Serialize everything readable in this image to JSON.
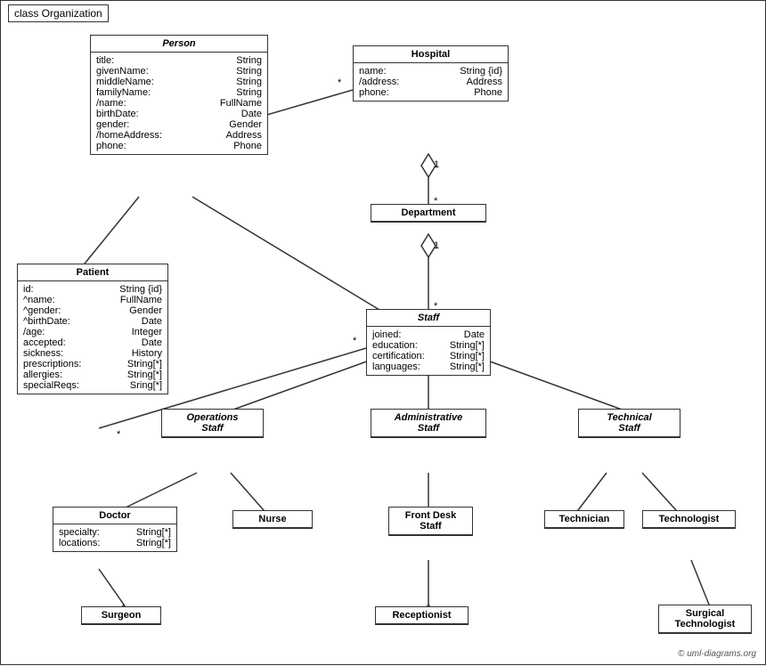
{
  "diagram": {
    "title": "class Organization",
    "copyright": "© uml-diagrams.org",
    "classes": {
      "person": {
        "name": "Person",
        "italic": true,
        "attrs": [
          {
            "name": "title:",
            "type": "String"
          },
          {
            "name": "givenName:",
            "type": "String"
          },
          {
            "name": "middleName:",
            "type": "String"
          },
          {
            "name": "familyName:",
            "type": "String"
          },
          {
            "name": "/name:",
            "type": "FullName"
          },
          {
            "name": "birthDate:",
            "type": "Date"
          },
          {
            "name": "gender:",
            "type": "Gender"
          },
          {
            "name": "/homeAddress:",
            "type": "Address"
          },
          {
            "name": "phone:",
            "type": "Phone"
          }
        ]
      },
      "hospital": {
        "name": "Hospital",
        "italic": false,
        "attrs": [
          {
            "name": "name:",
            "type": "String {id}"
          },
          {
            "name": "/address:",
            "type": "Address"
          },
          {
            "name": "phone:",
            "type": "Phone"
          }
        ]
      },
      "patient": {
        "name": "Patient",
        "italic": false,
        "attrs": [
          {
            "name": "id:",
            "type": "String {id}"
          },
          {
            "name": "^name:",
            "type": "FullName"
          },
          {
            "name": "^gender:",
            "type": "Gender"
          },
          {
            "name": "^birthDate:",
            "type": "Date"
          },
          {
            "name": "/age:",
            "type": "Integer"
          },
          {
            "name": "accepted:",
            "type": "Date"
          },
          {
            "name": "sickness:",
            "type": "History"
          },
          {
            "name": "prescriptions:",
            "type": "String[*]"
          },
          {
            "name": "allergies:",
            "type": "String[*]"
          },
          {
            "name": "specialReqs:",
            "type": "Sring[*]"
          }
        ]
      },
      "department": {
        "name": "Department",
        "italic": false,
        "attrs": []
      },
      "staff": {
        "name": "Staff",
        "italic": true,
        "attrs": [
          {
            "name": "joined:",
            "type": "Date"
          },
          {
            "name": "education:",
            "type": "String[*]"
          },
          {
            "name": "certification:",
            "type": "String[*]"
          },
          {
            "name": "languages:",
            "type": "String[*]"
          }
        ]
      },
      "operations_staff": {
        "name": "Operations\nStaff",
        "italic": true,
        "attrs": []
      },
      "administrative_staff": {
        "name": "Administrative\nStaff",
        "italic": true,
        "attrs": []
      },
      "technical_staff": {
        "name": "Technical\nStaff",
        "italic": true,
        "attrs": []
      },
      "doctor": {
        "name": "Doctor",
        "italic": false,
        "attrs": [
          {
            "name": "specialty:",
            "type": "String[*]"
          },
          {
            "name": "locations:",
            "type": "String[*]"
          }
        ]
      },
      "nurse": {
        "name": "Nurse",
        "italic": false,
        "attrs": []
      },
      "front_desk_staff": {
        "name": "Front Desk\nStaff",
        "italic": false,
        "attrs": []
      },
      "technician": {
        "name": "Technician",
        "italic": false,
        "attrs": []
      },
      "technologist": {
        "name": "Technologist",
        "italic": false,
        "attrs": []
      },
      "surgeon": {
        "name": "Surgeon",
        "italic": false,
        "attrs": []
      },
      "receptionist": {
        "name": "Receptionist",
        "italic": false,
        "attrs": []
      },
      "surgical_technologist": {
        "name": "Surgical\nTechnologist",
        "italic": false,
        "attrs": []
      }
    }
  }
}
